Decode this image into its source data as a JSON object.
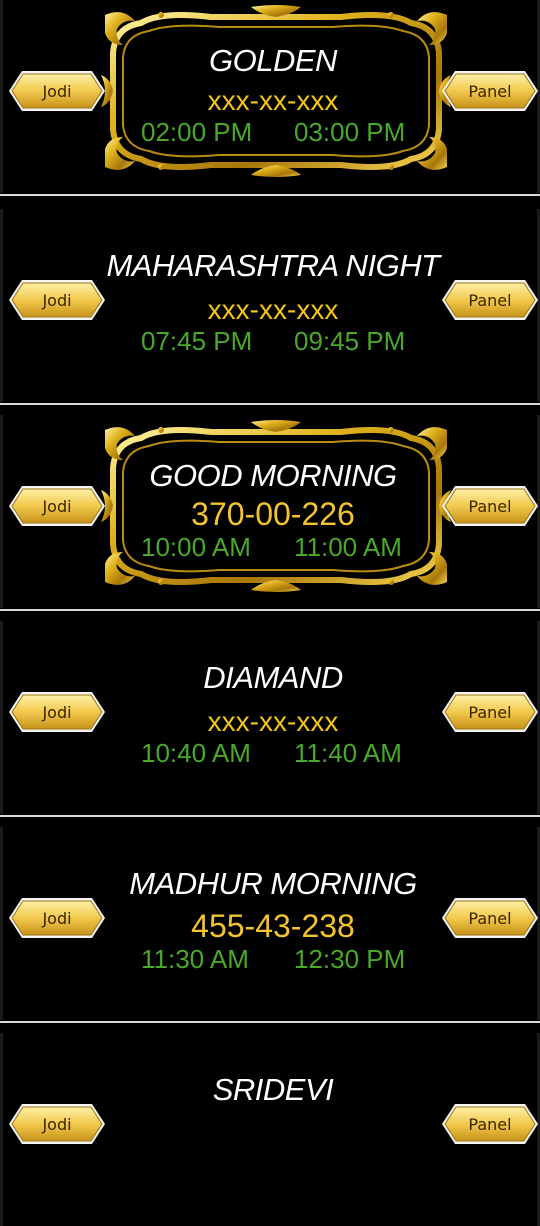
{
  "colors": {
    "background": "#000000",
    "title": "#ffffff",
    "result": "#f5c518",
    "time": "#49a82a",
    "button": "#f2c94c"
  },
  "icons": {
    "frame": "ornate-gold-frame-icon"
  },
  "markets": [
    {
      "title": "GOLDEN",
      "result": "xxx-xx-xxx",
      "open_time": "02:00 PM",
      "close_time": "03:00 PM",
      "jodi_label": "Jodi",
      "panel_label": "Panel",
      "framed": true
    },
    {
      "title": "MAHARASHTRA NIGHT",
      "result": "xxx-xx-xxx",
      "open_time": "07:45 PM",
      "close_time": "09:45 PM",
      "jodi_label": "Jodi",
      "panel_label": "Panel",
      "framed": false
    },
    {
      "title": "GOOD MORNING",
      "result": "370-00-226",
      "open_time": "10:00 AM",
      "close_time": "11:00 AM",
      "jodi_label": "Jodi",
      "panel_label": "Panel",
      "framed": true
    },
    {
      "title": "DIAMAND",
      "result": "xxx-xx-xxx",
      "open_time": "10:40 AM",
      "close_time": "11:40 AM",
      "jodi_label": "Jodi",
      "panel_label": "Panel",
      "framed": false
    },
    {
      "title": "MADHUR MORNING",
      "result": "455-43-238",
      "open_time": "11:30 AM",
      "close_time": "12:30 PM",
      "jodi_label": "Jodi",
      "panel_label": "Panel",
      "framed": false
    },
    {
      "title": "SRIDEVI",
      "result": "",
      "open_time": "",
      "close_time": "",
      "jodi_label": "Jodi",
      "panel_label": "Panel",
      "framed": false
    }
  ]
}
